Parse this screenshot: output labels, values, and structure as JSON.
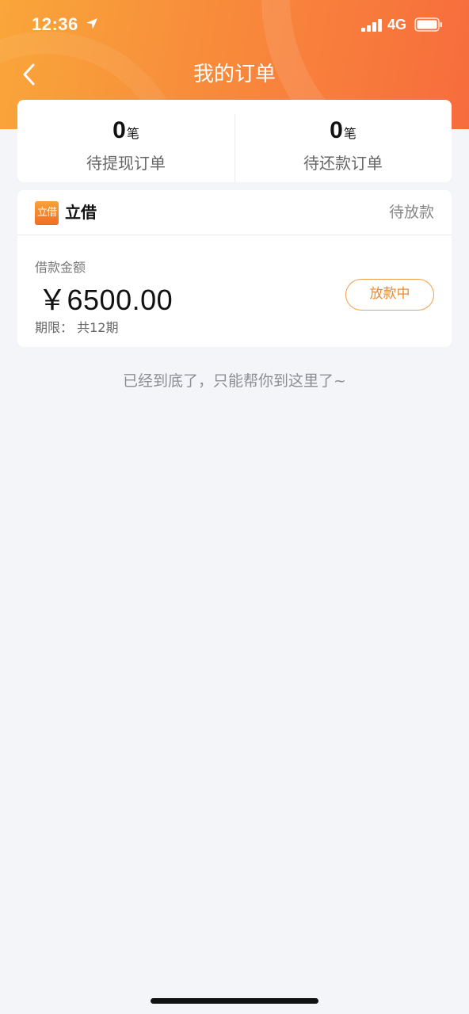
{
  "status_bar": {
    "time": "12:36",
    "network": "4G",
    "icons": [
      "location-arrow-icon",
      "signal-icon",
      "battery-icon"
    ]
  },
  "nav": {
    "title": "我的订单",
    "back_icon": "chevron-left-icon"
  },
  "summary": {
    "pending_withdrawal": {
      "count": "0",
      "unit": "笔",
      "label": "待提现订单"
    },
    "pending_repayment": {
      "count": "0",
      "unit": "笔",
      "label": "待还款订单"
    }
  },
  "order": {
    "lender_logo_text": "立借",
    "lender_name": "立借",
    "status": "待放款",
    "amount_label": "借款金额",
    "amount": "￥6500.00",
    "term": "期限：  共12期",
    "button_label": "放款中"
  },
  "footer_tip": "已经到底了，只能帮你到这里了~",
  "colors": {
    "header_gradient_start": "#f9a63a",
    "header_gradient_end": "#f76c3d",
    "page_background": "#f4f5f9",
    "accent": "#ec8a2c"
  }
}
